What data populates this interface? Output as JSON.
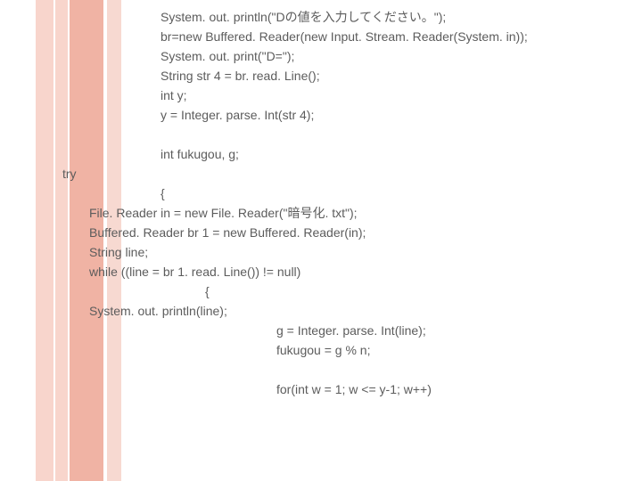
{
  "codeA": [
    "System. out. println(\"Dの値を入力してください。\");",
    "br=new Buffered. Reader(new Input. Stream. Reader(System. in));",
    "System. out. print(\"D=\");",
    "String str 4 = br. read. Line();",
    "int y;",
    "y = Integer. parse. Int(str 4);"
  ],
  "codeA2": [
    "int fukugou, g;"
  ],
  "tryLine": "try",
  "openBraceA": "{",
  "codeB": [
    "File. Reader in = new File. Reader(\"暗号化. txt\");",
    "Buffered. Reader br 1 = new Buffered. Reader(in);",
    "String line;",
    "while ((line = br 1. read. Line()) != null)"
  ],
  "openBraceB": "{",
  "codeC": [
    "System. out. println(line);"
  ],
  "codeD": [
    "g = Integer. parse. Int(line);",
    "fukugou = g % n;"
  ],
  "codeE": [
    "for(int w = 1; w <= y-1; w++)"
  ]
}
